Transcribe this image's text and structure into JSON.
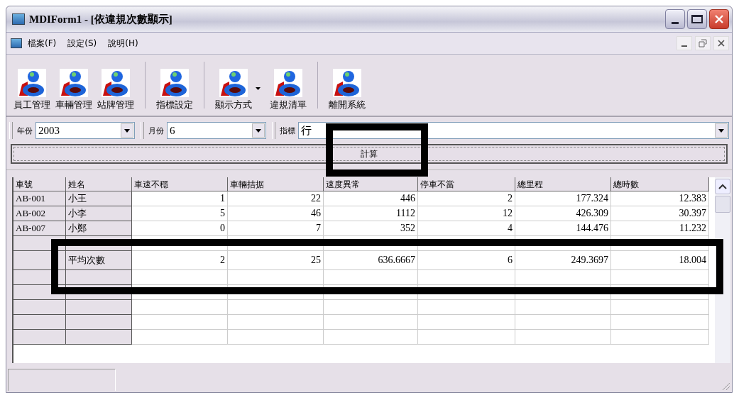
{
  "window": {
    "title": "MDIForm1 - [依違規次數顯示]"
  },
  "menu": [
    {
      "label": "檔案(F)"
    },
    {
      "label": "設定(S)"
    },
    {
      "label": "說明(H)"
    }
  ],
  "toolbar": [
    {
      "buttons": [
        {
          "label": "員工管理",
          "kind": "plain"
        },
        {
          "label": "車輛管理",
          "kind": "plain"
        },
        {
          "label": "站牌管理",
          "kind": "plain"
        }
      ]
    },
    {
      "buttons": [
        {
          "label": "指標設定",
          "kind": "plain"
        }
      ]
    },
    {
      "buttons": [
        {
          "label": "顯示方式",
          "kind": "dropdown"
        },
        {
          "label": "違規清單",
          "kind": "plain"
        }
      ]
    },
    {
      "buttons": [
        {
          "label": "離開系統",
          "kind": "plain"
        }
      ]
    }
  ],
  "filters": [
    {
      "label": "年份",
      "value": "2003"
    },
    {
      "label": "月份",
      "value": "6"
    },
    {
      "label": "指標",
      "value": "行"
    }
  ],
  "compute_button": {
    "label": "計算",
    "highlighted": true
  },
  "table": {
    "columns": [
      "車號",
      "姓名",
      "車速不穩",
      "車輛拮据",
      "速度異常",
      "停車不當",
      "總里程",
      "總時數"
    ],
    "rows": [
      {
        "kind": "data",
        "cells": [
          "AB-001",
          "小王",
          "1",
          "22",
          "446",
          "2",
          "177.324",
          "12.383"
        ]
      },
      {
        "kind": "data",
        "cells": [
          "AB-002",
          "小李",
          "5",
          "46",
          "1112",
          "12",
          "426.309",
          "30.397"
        ]
      },
      {
        "kind": "data",
        "cells": [
          "AB-007",
          "小鄭",
          "0",
          "7",
          "352",
          "4",
          "144.476",
          "11.232"
        ]
      },
      {
        "kind": "blank"
      },
      {
        "kind": "average",
        "label": "平均次數",
        "values": [
          "2",
          "25",
          "636.6667",
          "6",
          "249.3697",
          "18.004"
        ],
        "highlighted": true
      },
      {
        "kind": "blank"
      },
      {
        "kind": "blank"
      },
      {
        "kind": "blank"
      },
      {
        "kind": "blank"
      },
      {
        "kind": "blank"
      }
    ]
  }
}
